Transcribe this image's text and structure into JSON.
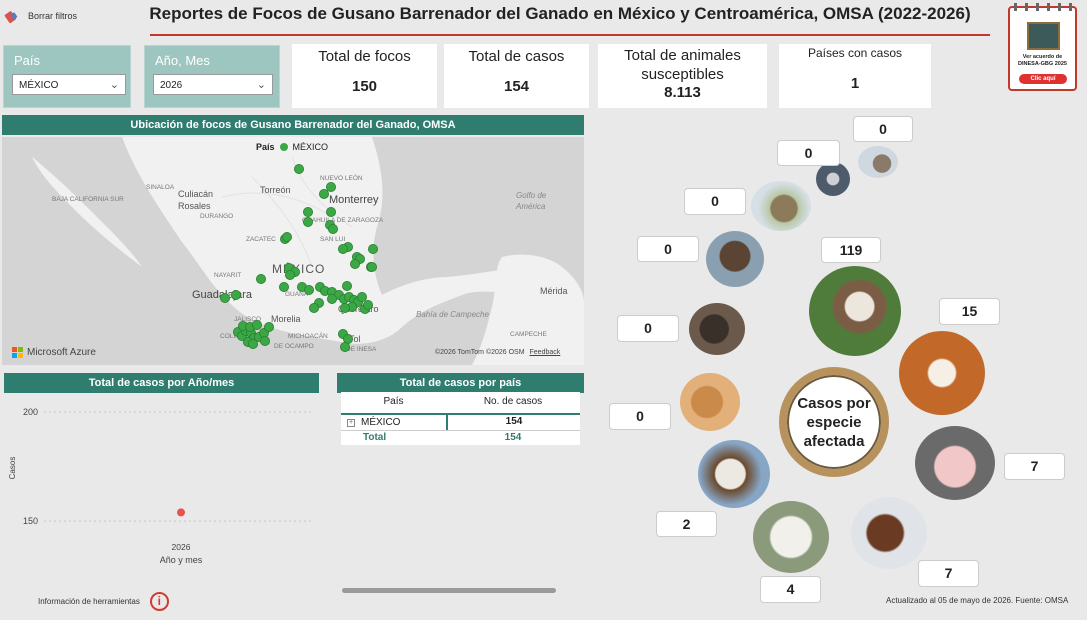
{
  "header": {
    "clear_filters": "Borrar filtros",
    "title": "Reportes de Focos de Gusano Barrenador del Ganado en México y Centroamérica, OMSA (2022-2026)"
  },
  "slicers": {
    "country_label": "País",
    "country_value": "MÉXICO",
    "period_label": "Año, Mes",
    "period_value": "2026"
  },
  "kpis": [
    {
      "title": "Total de focos",
      "value": "150"
    },
    {
      "title": "Total de casos",
      "value": "154"
    },
    {
      "title": "Total de animales susceptibles",
      "value": "8.113"
    },
    {
      "title": "Países con casos",
      "value": "1"
    }
  ],
  "agreement": {
    "text": "Ver acuerdo de DINESA-GBG 2025",
    "button": "Clic aquí"
  },
  "map": {
    "title": "Ubicación de focos de Gusano Barrenador del Ganado, OMSA",
    "legend_label": "País",
    "legend_item": "MÉXICO",
    "brand": "Microsoft Azure",
    "attribution": "©2026 TomTom  ©2026 OSM",
    "feedback": "Feedback",
    "place_labels": [
      "SINALOA",
      "Culiacán",
      "Rosales",
      "BAJA CALIFORNIA SUR",
      "Torreón",
      "NUEVO LEÓN",
      "Monterrey",
      "Golfo de",
      "América",
      "ZACATEC",
      "SAN LUI",
      "MÉXICO",
      "NAYARIT",
      "JALISCO",
      "Guadalajara",
      "GUANA",
      "Morelia",
      "Querétaro",
      "Mérida",
      "Bahía de Campeche",
      "CAMPECHE",
      "Tol",
      "DE INESA",
      "DE OCAMPO",
      "DURANGO",
      "COAHUILA DE ZARAGOZA",
      "COLIMA",
      "MICHOACÁN"
    ],
    "legend_color": "#3aa845"
  },
  "line_chart": {
    "title": "Total de casos por Año/mes",
    "ylabel": "Casos",
    "xlabel": "Año y mes"
  },
  "country_table": {
    "title": "Total de casos por país",
    "col_country": "País",
    "col_cases": "No. de casos",
    "row_country": "MÉXICO",
    "row_cases": "154",
    "total_label": "Total",
    "total_cases": "154"
  },
  "species": {
    "center_label": "Casos por especie afectada",
    "counts": {
      "rabbit_small": "0",
      "goose": "0",
      "hare": "0",
      "buffalo": "0",
      "cattle": "119",
      "wild_boar": "0",
      "dog": "15",
      "cat": "0",
      "pig": "7",
      "goat": "2",
      "sheep": "4",
      "horse": "7"
    }
  },
  "footer": {
    "tools_info": "Información de herramientas",
    "updated": "Actualizado al 05 de mayo de 2026. Fuente: OMSA"
  },
  "chart_data": {
    "type": "line",
    "title": "Total de casos por Año/mes",
    "xlabel": "Año y mes",
    "ylabel": "Casos",
    "categories": [
      "2026"
    ],
    "values": [
      154
    ],
    "yticks": [
      150,
      200
    ],
    "grid": true,
    "point_color": "#e5534b"
  }
}
